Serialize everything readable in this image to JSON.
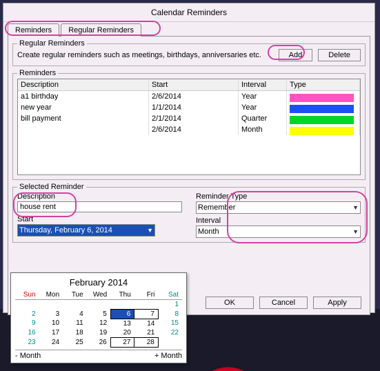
{
  "window": {
    "title": "Calendar Reminders"
  },
  "tabs": {
    "reminders": "Reminders",
    "regular": "Regular Reminders"
  },
  "regularBox": {
    "legend": "Regular Reminders",
    "desc": "Create regular reminders such as meetings, birthdays, anniversaries etc.",
    "add": "Add",
    "delete": "Delete"
  },
  "remindersBox": {
    "legend": "Reminders",
    "headers": {
      "description": "Description",
      "start": "Start",
      "interval": "Interval",
      "type": "Type"
    },
    "rows": [
      {
        "description": "a1 birthday",
        "start": "2/6/2014",
        "interval": "Year",
        "color": "#ff53c3"
      },
      {
        "description": "new year",
        "start": "1/1/2014",
        "interval": "Year",
        "color": "#1a4fff"
      },
      {
        "description": "bill payment",
        "start": "2/1/2014",
        "interval": "Quarter",
        "color": "#00d42a"
      },
      {
        "description": "",
        "start": "2/6/2014",
        "interval": "Month",
        "color": "#ffff00"
      }
    ]
  },
  "selectedBox": {
    "legend": "Selected Reminder",
    "descLabel": "Description",
    "descValue": "house rent",
    "startLabel": "Start",
    "startValue": "Thursday, February 6, 2014",
    "typeLabel": "Reminder Type",
    "typeValue": "Remember",
    "intervalLabel": "Interval",
    "intervalValue": "Month"
  },
  "buttons": {
    "ok": "OK",
    "cancel": "Cancel",
    "apply": "Apply"
  },
  "calendar": {
    "title": "February 2014",
    "dow": [
      "Sun",
      "Mon",
      "Tue",
      "Wed",
      "Thu",
      "Fri",
      "Sat"
    ],
    "prev": "- Month",
    "next": "+ Month",
    "weeks": [
      [
        "",
        "",
        "",
        "",
        "",
        "",
        1
      ],
      [
        2,
        3,
        4,
        5,
        6,
        7,
        8
      ],
      [
        9,
        10,
        11,
        12,
        13,
        14,
        15
      ],
      [
        16,
        17,
        18,
        19,
        20,
        21,
        22
      ],
      [
        23,
        24,
        25,
        26,
        27,
        28,
        ""
      ]
    ]
  }
}
